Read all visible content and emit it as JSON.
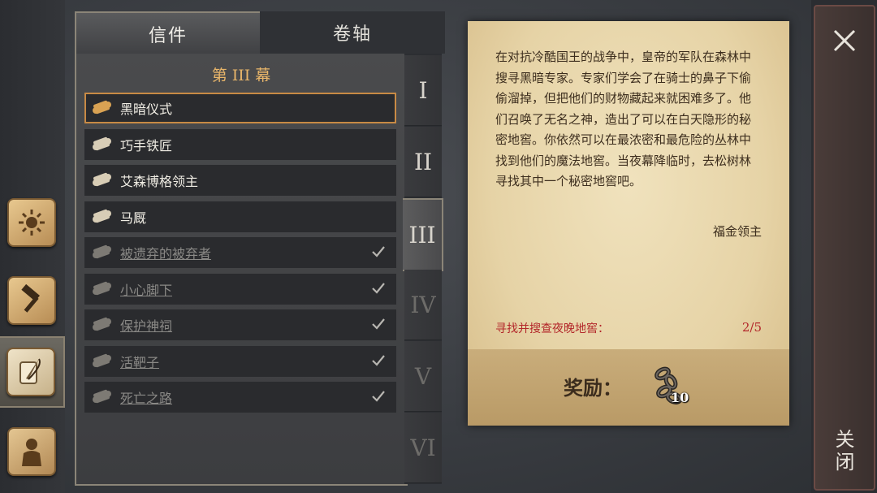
{
  "tabs": {
    "letters": "信件",
    "scrolls": "卷轴"
  },
  "act_title": "第 III 幕",
  "quests": [
    {
      "label": "黑暗仪式",
      "selected": true,
      "completed": false
    },
    {
      "label": "巧手铁匠",
      "selected": false,
      "completed": false
    },
    {
      "label": "艾森博格领主",
      "selected": false,
      "completed": false
    },
    {
      "label": "马厩",
      "selected": false,
      "completed": false
    },
    {
      "label": "被遗弃的被弃者",
      "selected": false,
      "completed": true
    },
    {
      "label": "小心脚下",
      "selected": false,
      "completed": true
    },
    {
      "label": "保护神祠",
      "selected": false,
      "completed": true
    },
    {
      "label": "活靶子",
      "selected": false,
      "completed": true
    },
    {
      "label": "死亡之路",
      "selected": false,
      "completed": true
    }
  ],
  "chapters": [
    "I",
    "II",
    "III",
    "IV",
    "V",
    "VI"
  ],
  "active_chapter": "III",
  "letter": {
    "body": "在对抗冷酷国王的战争中，皇帝的军队在森林中搜寻黑暗专家。专家们学会了在骑士的鼻子下偷偷溜掉，但把他们的财物藏起来就困难多了。他们召唤了无名之神，造出了可以在白天隐形的秘密地窖。你依然可以在最浓密和最危险的丛林中找到他们的魔法地窖。当夜幕降临时，去松树林寻找其中一个秘密地窖吧。",
    "signature": "福金领主",
    "objective": "寻找并搜查夜晚地窖：",
    "progress": "2/5",
    "reward_label": "奖励：",
    "reward_icon": "chain-icon",
    "reward_count": "10"
  },
  "close_label": "关闭",
  "colors": {
    "accent": "#e9b66a",
    "objective": "#b3272a",
    "selected_border": "#c88a45"
  }
}
